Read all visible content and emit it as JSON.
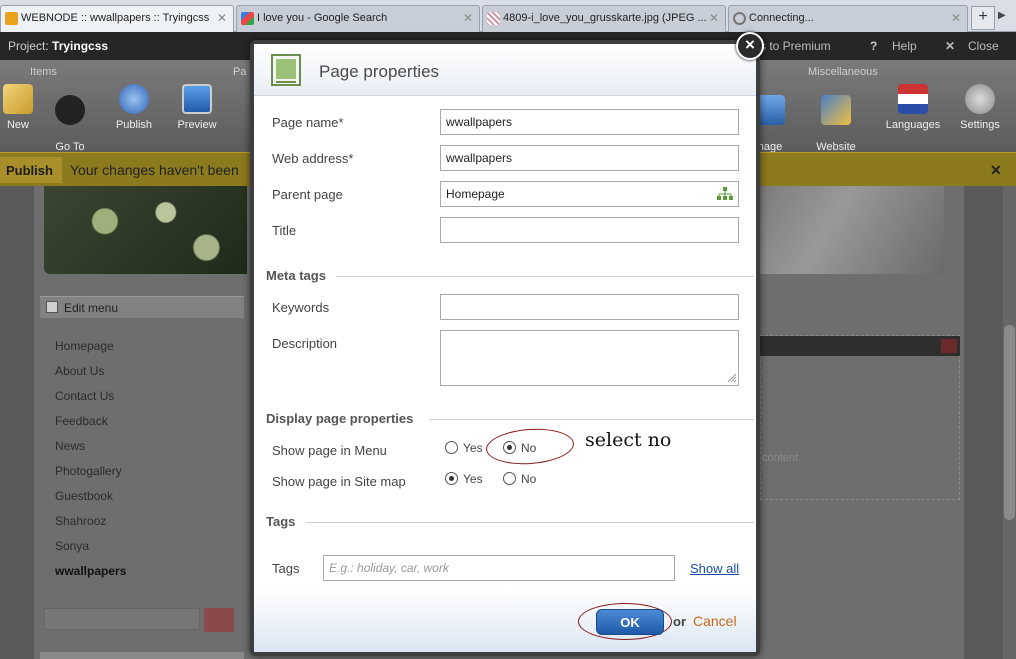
{
  "browser": {
    "tabs": [
      {
        "title": "WEBNODE :: wwallpapers :: Tryingcss",
        "active": true
      },
      {
        "title": "I love you - Google Search",
        "active": false
      },
      {
        "title": "4809-i_love_you_grusskarte.jpg (JPEG ...",
        "active": false
      },
      {
        "title": "Connecting...",
        "active": false
      }
    ],
    "new_tab": "+"
  },
  "project": {
    "label": "Project:",
    "name": "Tryingcss",
    "premium": "s to Premium",
    "help": "Help",
    "close": "Close"
  },
  "toolbar": {
    "groups": {
      "items": "Items",
      "pa": "Pa",
      "misc": "Miscellaneous"
    },
    "buttons": {
      "new": "New",
      "goto": "Go To\nPage",
      "publish": "Publish",
      "preview": "Preview",
      "page_browser": "nage\nowser",
      "website_template": "Website\ntemplate",
      "languages": "Languages",
      "settings": "Settings"
    }
  },
  "publish_bar": {
    "button": "Publish",
    "message": "Your changes haven't been"
  },
  "background_page": {
    "edit_menu": "Edit menu",
    "nav": [
      "Homepage",
      "About Us",
      "Contact Us",
      "Feedback",
      "News",
      "Photogallery",
      "Guestbook",
      "Shahrooz",
      "Sonya",
      "wwallpapers"
    ],
    "current_nav": "wwallpapers",
    "placeholder_content": "content."
  },
  "dialog": {
    "title": "Page properties",
    "close": "×",
    "fields": {
      "page_name_label": "Page name",
      "page_name_value": "wwallpapers",
      "web_address_label": "Web address",
      "web_address_value": "wwallpapers",
      "required_mark": "*",
      "parent_page_label": "Parent page",
      "parent_page_value": "Homepage",
      "title_label": "Title",
      "title_value": ""
    },
    "meta": {
      "heading": "Meta tags",
      "keywords_label": "Keywords",
      "keywords_value": "",
      "description_label": "Description",
      "description_value": ""
    },
    "display": {
      "heading": "Display page properties",
      "menu_label": "Show page in Menu",
      "sitemap_label": "Show page in Site map",
      "yes": "Yes",
      "no": "No",
      "menu_selected": "No",
      "sitemap_selected": "Yes"
    },
    "tags": {
      "heading": "Tags",
      "label": "Tags",
      "placeholder": "E.g.: holiday, car, work",
      "show_all": "Show all"
    },
    "footer": {
      "ok": "OK",
      "or": "or",
      "cancel": "Cancel"
    }
  },
  "annotation": {
    "text": "select no"
  },
  "colors": {
    "ok_button": "#1e5aa8",
    "cancel_link": "#c26a18",
    "annotation_ring": "#8b1a1a",
    "publish_bar": "#8c7a1e"
  }
}
